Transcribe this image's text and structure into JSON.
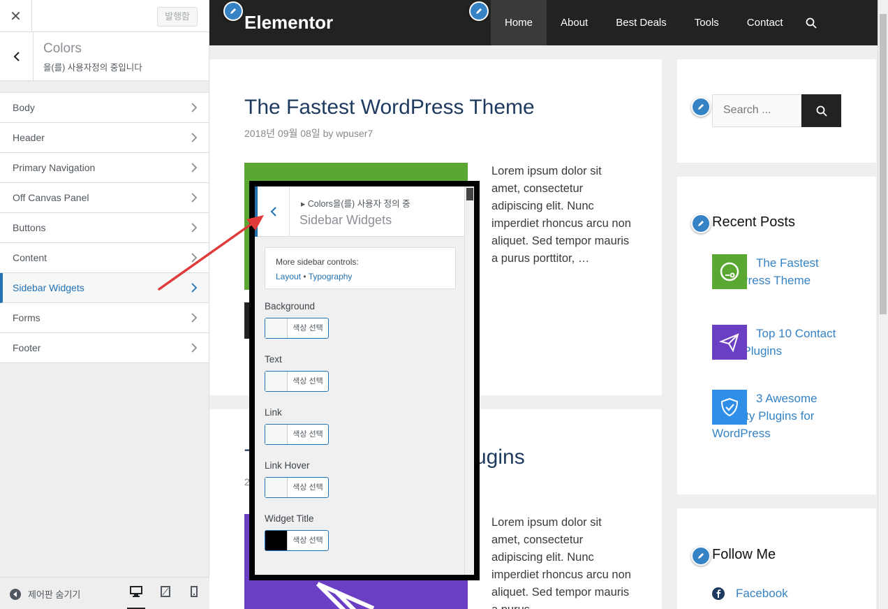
{
  "customizer": {
    "close_glyph": "✕",
    "publish_label": "발행함",
    "section_title": "Colors",
    "section_subtitle": "을(를) 사용자정의 중입니다",
    "items": [
      {
        "label": "Body"
      },
      {
        "label": "Header"
      },
      {
        "label": "Primary Navigation"
      },
      {
        "label": "Off Canvas Panel"
      },
      {
        "label": "Buttons"
      },
      {
        "label": "Content"
      },
      {
        "label": "Sidebar Widgets",
        "active": true
      },
      {
        "label": "Forms"
      },
      {
        "label": "Footer"
      }
    ],
    "footer": {
      "hide_label": "제어판 숨기기",
      "devices": [
        "desktop-icon",
        "tablet-icon",
        "mobile-icon"
      ],
      "active_device": "desktop"
    }
  },
  "site": {
    "title": "Elementor",
    "nav": [
      "Home",
      "About",
      "Best Deals",
      "Tools",
      "Contact"
    ],
    "nav_current": "Home",
    "posts": [
      {
        "title": "The Fastest WordPress Theme",
        "meta_date": "2018년 09월 08일",
        "meta_by": "by",
        "meta_author": "wpuser7",
        "excerpt": "Lorem ipsum dolor sit amet, consectetur adipiscing elit. Nunc imperdiet rhoncus arcu non aliquet. Sed tempor mauris a purus porttitor, …",
        "image_color": "#5aa832"
      },
      {
        "title_fragment": "T",
        "title_tail": "ugins",
        "meta_fragment": "2",
        "excerpt": "Lorem ipsum dolor sit amet, consectetur adipiscing elit. Nunc imperdiet rhoncus arcu non aliquet. Sed tempor mauris a purus …",
        "image_color": "#6b3fc4"
      }
    ],
    "search_placeholder": "Search ...",
    "recent_title": "Recent Posts",
    "recent_posts": [
      {
        "title": "The Fastest WordPress Theme",
        "icon": "speedometer-icon",
        "color": "#5aa832"
      },
      {
        "title": "Top 10 Contact Form Plugins",
        "icon": "paper-plane-icon",
        "color": "#6b3fc4"
      },
      {
        "title": "3 Awesome Security Plugins for WordPress",
        "icon": "shield-check-icon",
        "color": "#2f8ee8"
      }
    ],
    "follow_title": "Follow Me",
    "follow_links": [
      {
        "label": "Facebook",
        "icon": "facebook-icon"
      }
    ]
  },
  "zoom_panel": {
    "breadcrumb": "▸ Colors을(를) 사용자 정의 중",
    "title": "Sidebar Widgets",
    "more_label": "More sidebar controls:",
    "link_layout": "Layout",
    "link_sep": "•",
    "link_typography": "Typography",
    "controls": [
      {
        "label": "Background",
        "button": "색상 선택",
        "swatch": "#f6f7f7"
      },
      {
        "label": "Text",
        "button": "색상 선택",
        "swatch": "#f6f7f7"
      },
      {
        "label": "Link",
        "button": "색상 선택",
        "swatch": "#f6f7f7"
      },
      {
        "label": "Link Hover",
        "button": "색상 선택",
        "swatch": "#f6f7f7"
      },
      {
        "label": "Widget Title",
        "button": "색상 선택",
        "swatch": "#000000"
      }
    ]
  },
  "colors": {
    "accent": "#2271b1",
    "link": "#3582c4",
    "header_bg": "#222222",
    "arrow": "#e03a3a"
  }
}
